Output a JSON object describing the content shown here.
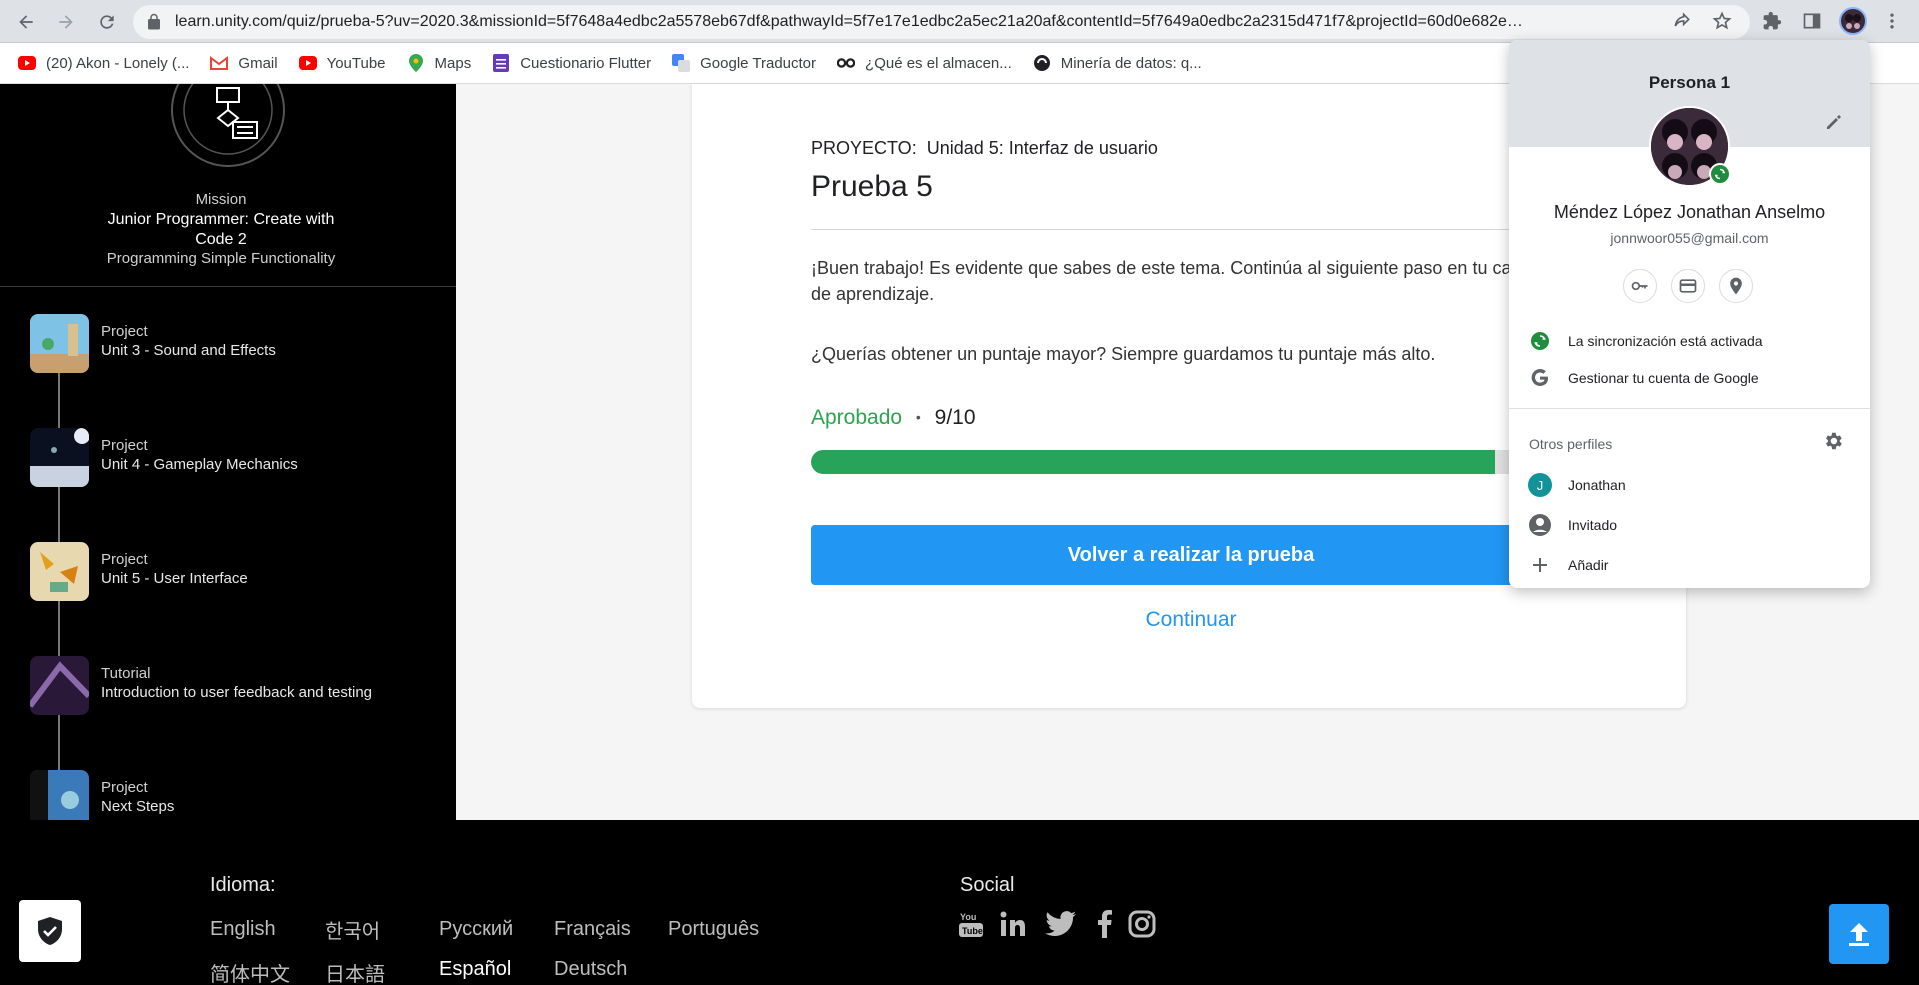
{
  "browser": {
    "url": "learn.unity.com/quiz/prueba-5?uv=2020.3&missionId=5f7648a4edbc2a5578eb67df&pathwayId=5f7e17e1edbc2a5ec21a20af&contentId=5f7649a0edbc2a2315d471f7&projectId=60d0e682e…",
    "bookmarks": [
      {
        "label": "(20) Akon - Lonely (...",
        "icon": "youtube-icon",
        "color": "#ff0000"
      },
      {
        "label": "Gmail",
        "icon": "gmail-icon",
        "color": "#ea4335"
      },
      {
        "label": "YouTube",
        "icon": "youtube-icon",
        "color": "#ff0000"
      },
      {
        "label": "Maps",
        "icon": "maps-icon",
        "color": "#34a853"
      },
      {
        "label": "Cuestionario Flutter",
        "icon": "forms-icon",
        "color": "#673ab7"
      },
      {
        "label": "Google Traductor",
        "icon": "translate-icon",
        "color": "#4285f4"
      },
      {
        "label": "¿Qué es el almacen...",
        "icon": "site-icon",
        "color": "#202124"
      },
      {
        "label": "Minería de datos: q...",
        "icon": "site-icon",
        "color": "#202124"
      }
    ]
  },
  "sidebar": {
    "mission_label": "Mission",
    "mission_title": "Junior Programmer: Create with Code 2",
    "mission_subtitle": "Programming Simple Functionality",
    "items": [
      {
        "type": "Project",
        "name": "Unit 3 - Sound and Effects"
      },
      {
        "type": "Project",
        "name": "Unit 4 - Gameplay Mechanics"
      },
      {
        "type": "Project",
        "name": "Unit 5 - User Interface"
      },
      {
        "type": "Tutorial",
        "name": "Introduction to user feedback and testing"
      },
      {
        "type": "Project",
        "name": "Next Steps"
      }
    ]
  },
  "quiz": {
    "project_prefix": "PROYECTO:",
    "project_name": "Unidad 5: Interfaz de usuario",
    "title": "Prueba 5",
    "message": "¡Buen trabajo! Es evidente que sabes de este tema. Continúa al siguiente paso en tu camino de aprendizaje.",
    "higher_score_note": "¿Querías obtener un puntaje mayor? Siempre guardamos tu puntaje más alto.",
    "status": "Aprobado",
    "separator": "•",
    "score": "9/10",
    "progress": 0.9,
    "retry_label": "Volver a realizar la prueba",
    "continue_label": "Continuar"
  },
  "footer": {
    "language_title": "Idioma:",
    "languages": [
      "English",
      "한국어",
      "Русский",
      "Français",
      "Português",
      "简体中文",
      "日本語",
      "Español",
      "Deutsch"
    ],
    "selected_language": "Español",
    "social_title": "Social"
  },
  "profile": {
    "title": "Persona 1",
    "name": "Méndez López Jonathan Anselmo",
    "email": "jonnwoor055@gmail.com",
    "sync_label": "La sincronización está activada",
    "manage_label": "Gestionar tu cuenta de Google",
    "other_profiles_label": "Otros perfiles",
    "other_profiles": [
      {
        "initial": "J",
        "name": "Jonathan"
      },
      {
        "name": "Invitado"
      }
    ],
    "add_label": "Añadir"
  }
}
